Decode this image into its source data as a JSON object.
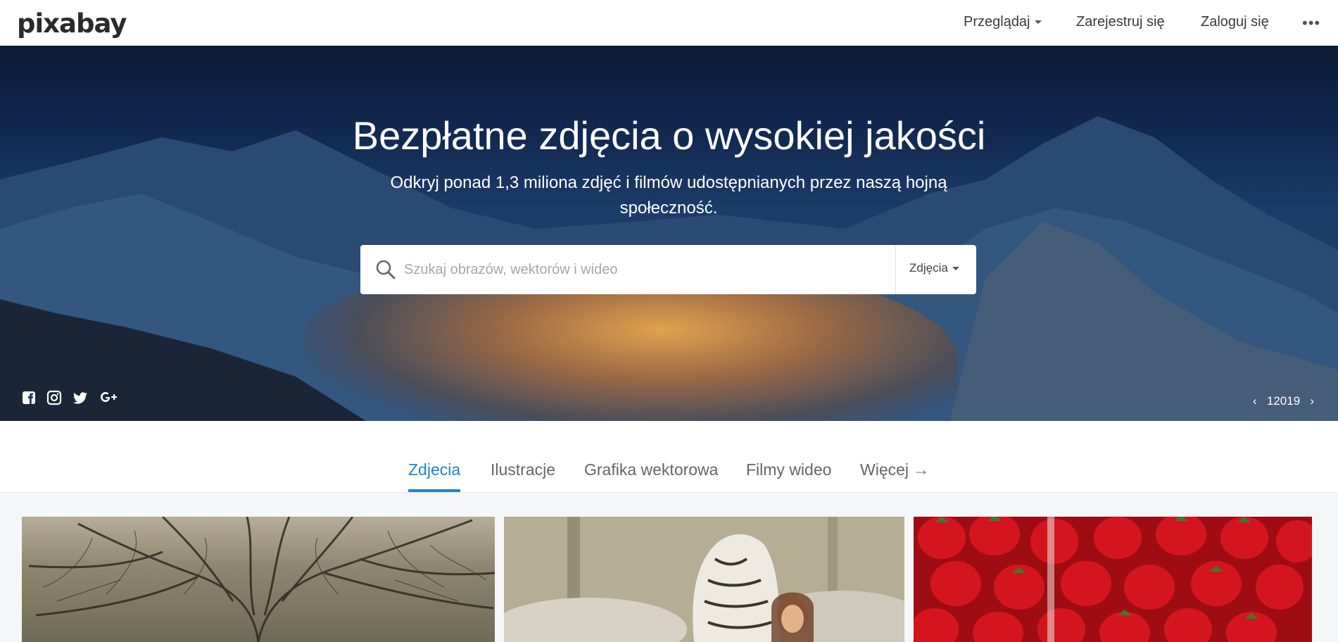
{
  "header": {
    "logo": "pixabay",
    "nav": {
      "browse": "Przeglądaj",
      "signup": "Zarejestruj się",
      "login": "Zaloguj się"
    },
    "more": "•••"
  },
  "hero": {
    "title": "Bezpłatne zdjęcia o wysokiej jakości",
    "subtitle": "Odkryj ponad 1,3 miliona zdjęć i filmów udostępnianych przez naszą hojną społeczność.",
    "search": {
      "placeholder": "Szukaj obrazów, wektorów i wideo",
      "value": "",
      "type_label": "Zdjęcia"
    },
    "social": [
      "facebook-icon",
      "instagram-icon",
      "twitter-icon",
      "google-plus-icon"
    ],
    "image_nav": {
      "prev": "‹",
      "label": "12019",
      "next": "›"
    }
  },
  "tabs": {
    "items": [
      "Zdjecia",
      "Ilustracje",
      "Grafika wektorowa",
      "Filmy wideo",
      "Więcej →"
    ],
    "active_index": 0
  },
  "colors": {
    "accent": "#2184c8",
    "header_bg": "#ffffff",
    "hero_text": "#ffffff"
  }
}
